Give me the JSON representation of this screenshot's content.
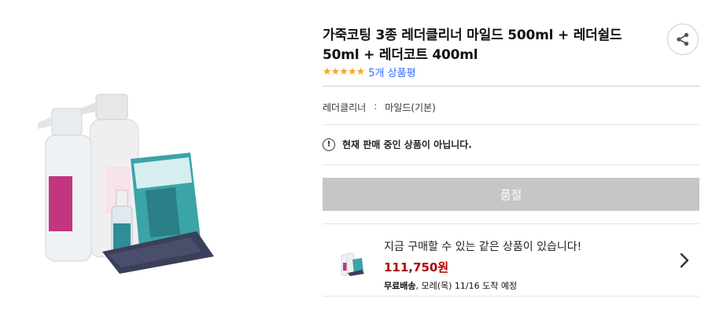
{
  "product": {
    "title": "가죽코팅 3종 레더클리너 마일드 500ml + 레더쉴드 50ml + 레더코트 400ml",
    "stars": "★★★★★",
    "review_link": "5개 상품평"
  },
  "option": {
    "label": "레더클리너",
    "separator": ":",
    "value": "마일드(기본)"
  },
  "notice": {
    "icon_text": "!",
    "text": "현재 판매 중인 상품이 아닙니다."
  },
  "buy_button": {
    "label": "품절"
  },
  "alternative": {
    "heading": "지금 구매할 수 있는 같은 상품이 있습니다!",
    "price": "111,750원",
    "shipping_label": "무료배송",
    "shipping_detail": ", 모레(목) 11/16 도착 예정"
  },
  "icons": {
    "share": "share-icon",
    "chevron": "chevron-right-icon",
    "alert": "exclamation-circle-icon"
  },
  "colors": {
    "star": "#f5a623",
    "link": "#346aff",
    "price": "#ae0000",
    "soldout_bg": "#c6c6c6"
  }
}
